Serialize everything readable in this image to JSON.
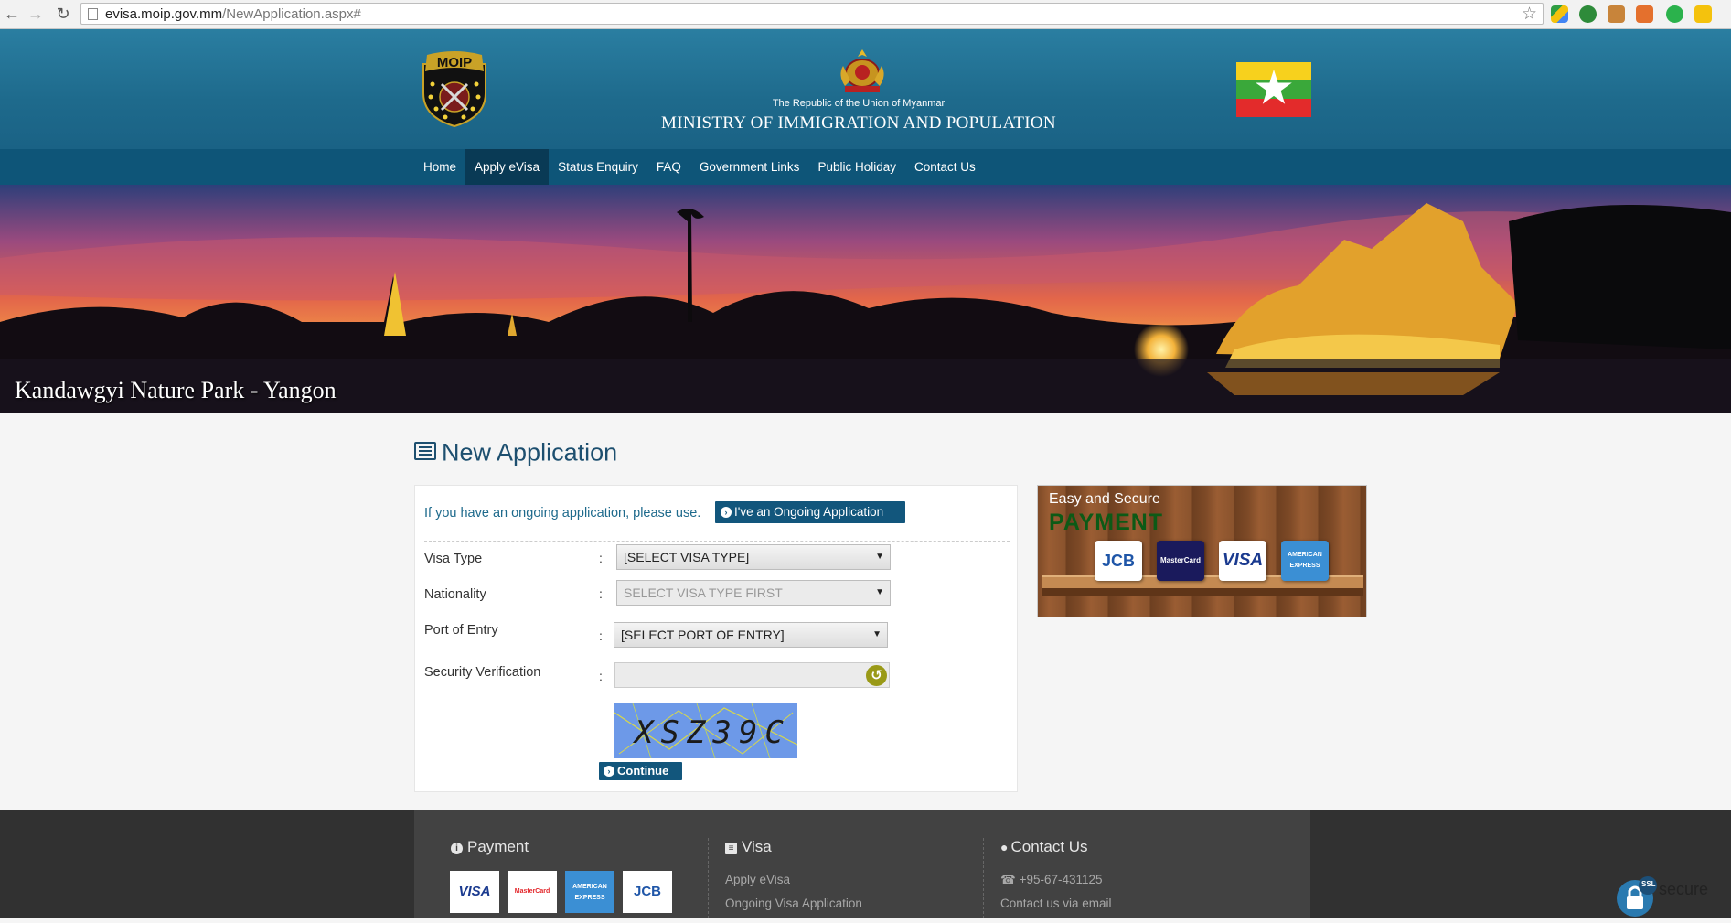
{
  "browser": {
    "url_domain": "evisa.moip.gov.mm",
    "url_path": "/NewApplication.aspx#",
    "back_icon": "arrow-left",
    "forward_icon": "arrow-right",
    "reload_icon": "reload"
  },
  "header": {
    "logo_text": "MOIP",
    "republic": "The Republic of the Union of Myanmar",
    "ministry": "MINISTRY OF IMMIGRATION AND POPULATION"
  },
  "nav": {
    "items": [
      "Home",
      "Apply eVisa",
      "Status Enquiry",
      "FAQ",
      "Government Links",
      "Public Holiday",
      "Contact Us"
    ],
    "active": "Apply eVisa"
  },
  "banner": {
    "caption": "Kandawgyi Nature Park - Yangon"
  },
  "page": {
    "title": "New Application"
  },
  "form": {
    "ongoing_text": "If you have an ongoing application, please use.",
    "ongoing_button": "I've an Ongoing Application",
    "colon": ":",
    "visa_type": {
      "label": "Visa Type",
      "value": "[SELECT VISA TYPE]"
    },
    "nationality": {
      "label": "Nationality",
      "value": "SELECT VISA TYPE FIRST"
    },
    "port_of_entry": {
      "label": "Port of Entry",
      "value": "[SELECT PORT OF ENTRY]"
    },
    "security": {
      "label": "Security Verification",
      "captcha": "XSZ39C"
    },
    "continue_button": "Continue"
  },
  "payment_panel": {
    "line1": "Easy and Secure",
    "line2": "PAYMENT",
    "cards": [
      "JCB",
      "MasterCard",
      "VISA",
      "AMERICAN EXPRESS"
    ]
  },
  "footer": {
    "payment": {
      "title": "Payment",
      "cards": [
        "VISA",
        "MasterCard",
        "AMERICAN EXPRESS",
        "JCB"
      ]
    },
    "visa": {
      "title": "Visa",
      "links": [
        "Apply eVisa",
        "Ongoing Visa Application"
      ]
    },
    "contact": {
      "title": "Contact Us",
      "phone": "+95-67-431125",
      "email": "Contact us via email"
    }
  },
  "ssl_badge": {
    "ssl": "SSL",
    "text": "secure"
  },
  "colors": {
    "header": "#1e6a8c",
    "navbar": "#0e5578",
    "nav_active": "#093a55",
    "button": "#12567c",
    "footer": "#424242"
  }
}
